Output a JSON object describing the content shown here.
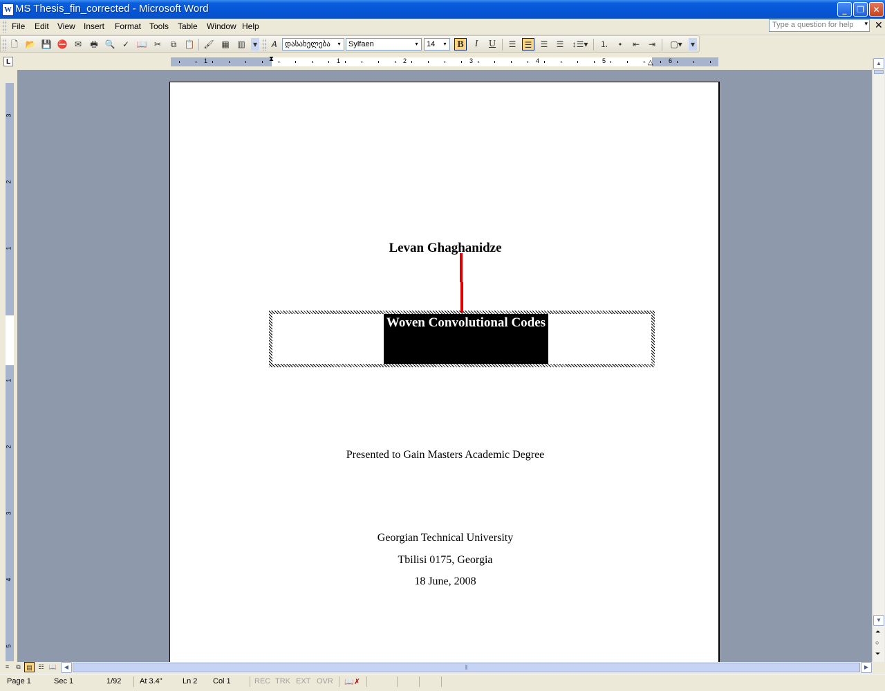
{
  "window": {
    "title": "MS Thesis_fin_corrected - Microsoft Word",
    "app_icon": "word-icon"
  },
  "menu": [
    "File",
    "Edit",
    "View",
    "Insert",
    "Format",
    "Tools",
    "Table",
    "Window",
    "Help"
  ],
  "help_box": {
    "placeholder": "Type a question for help"
  },
  "toolbar": {
    "style": "დასახელება",
    "font": "Sylfaen",
    "size": "14",
    "bold_active": true,
    "align_center_active": true
  },
  "ruler": {
    "h_numbers": [
      "1",
      "1",
      "2",
      "3",
      "4",
      "5",
      "6"
    ],
    "v_numbers": [
      "3",
      "2",
      "1",
      "1",
      "2",
      "3",
      "4",
      "5"
    ]
  },
  "document": {
    "author": "Levan Ghaghanidze",
    "title": "Woven Convolutional Codes",
    "presented": "Presented to Gain Masters Academic Degree",
    "university": "Georgian Technical University",
    "city": "Tbilisi 0175, Georgia",
    "date": "18 June, 2008"
  },
  "status": {
    "page": "Page  1",
    "sec": "Sec  1",
    "pages": "1/92",
    "at": "At  3.4\"",
    "ln": "Ln  2",
    "col": "Col  1",
    "rec": "REC",
    "trk": "TRK",
    "ext": "EXT",
    "ovr": "OVR"
  },
  "colors": {
    "titlebar": "#0556d6",
    "workspace": "#8f99ac",
    "annotation_line": "#e00000"
  }
}
